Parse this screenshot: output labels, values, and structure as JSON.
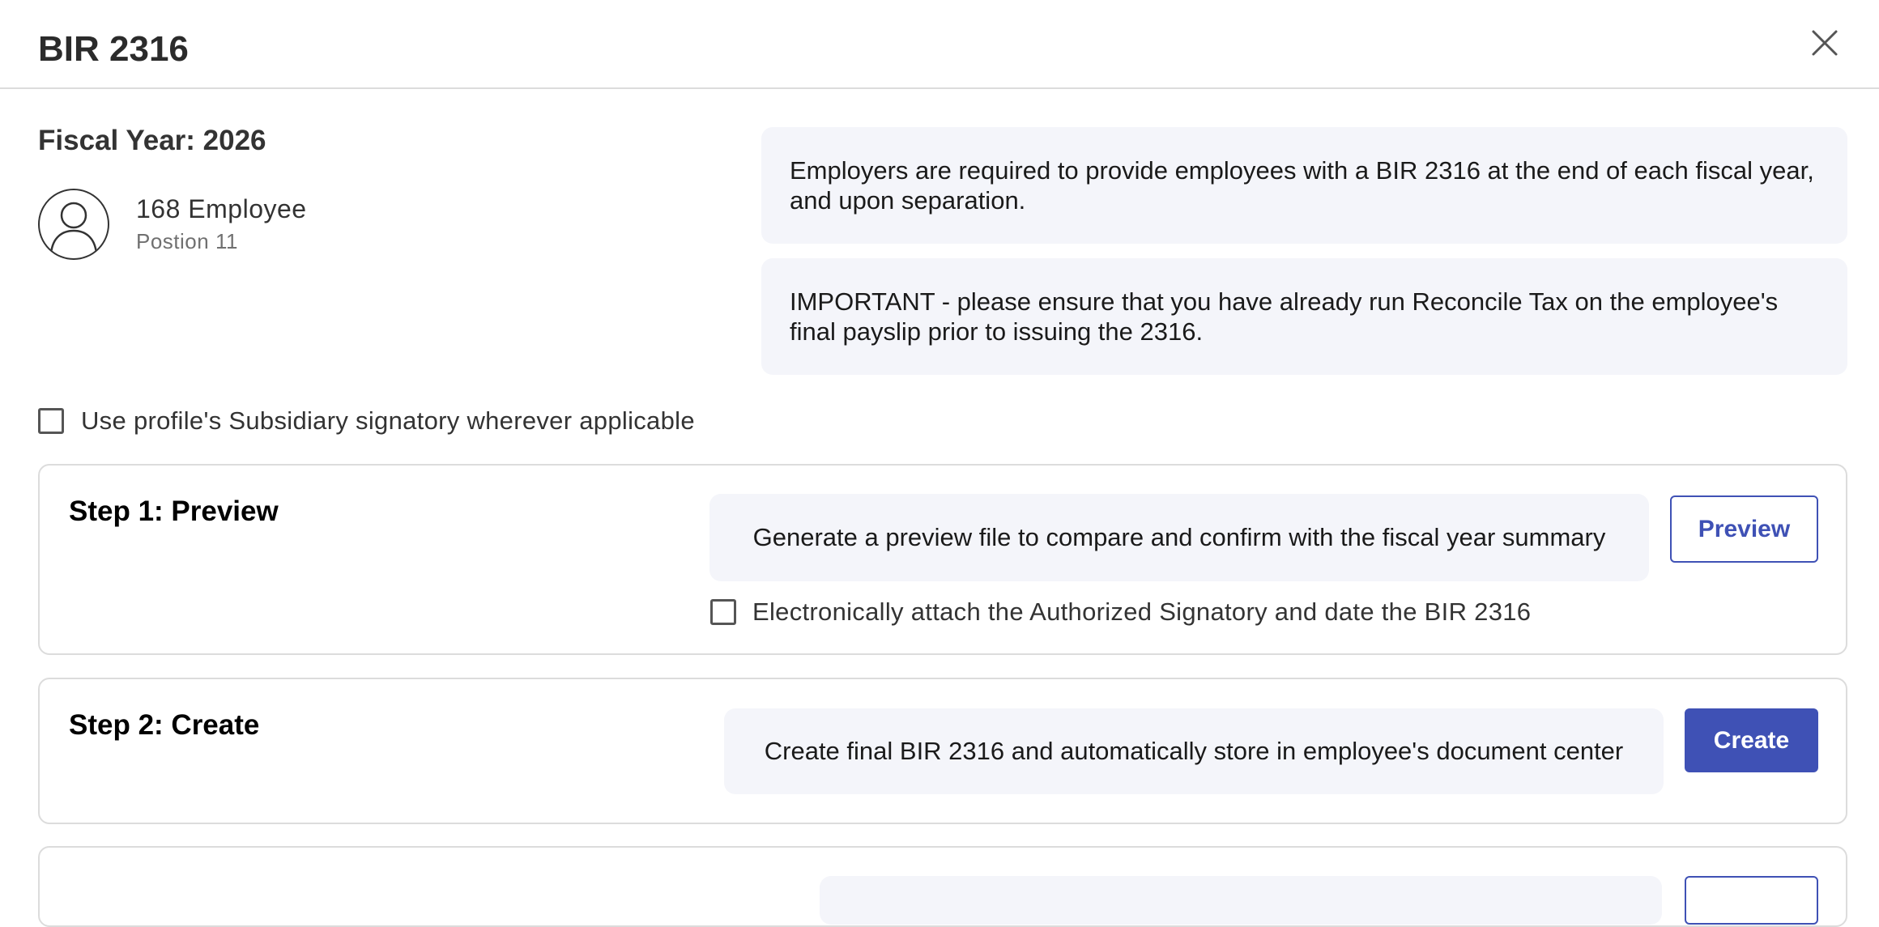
{
  "dialog": {
    "title": "BIR 2316",
    "close_icon": "close-icon"
  },
  "fiscal_year_label": "Fiscal Year: 2026",
  "employee": {
    "avatar_icon": "user-avatar-icon",
    "name": "168 Employee",
    "position": "Postion 11"
  },
  "info": {
    "message1": "Employers are required to provide employees with a BIR 2316 at the end of each fiscal year, and upon separation.",
    "message2": "IMPORTANT - please ensure that you have already run Reconcile Tax on the employee's final payslip prior to issuing the 2316."
  },
  "subsidiary_signatory": {
    "label": "Use profile's Subsidiary signatory wherever applicable",
    "checked": false
  },
  "steps": [
    {
      "title": "Step 1: Preview",
      "description": "Generate a preview file to compare and confirm with the fiscal year summary",
      "button_label": "Preview",
      "option_label": "Electronically attach the Authorized Signatory and date the BIR 2316",
      "option_checked": false
    },
    {
      "title": "Step 2: Create",
      "description": "Create final BIR 2316 and automatically store in employee's document center",
      "button_label": "Create"
    }
  ],
  "colors": {
    "accent": "#3f51b5",
    "panel_bg": "#f4f5fa",
    "border": "#dcdcdc"
  }
}
